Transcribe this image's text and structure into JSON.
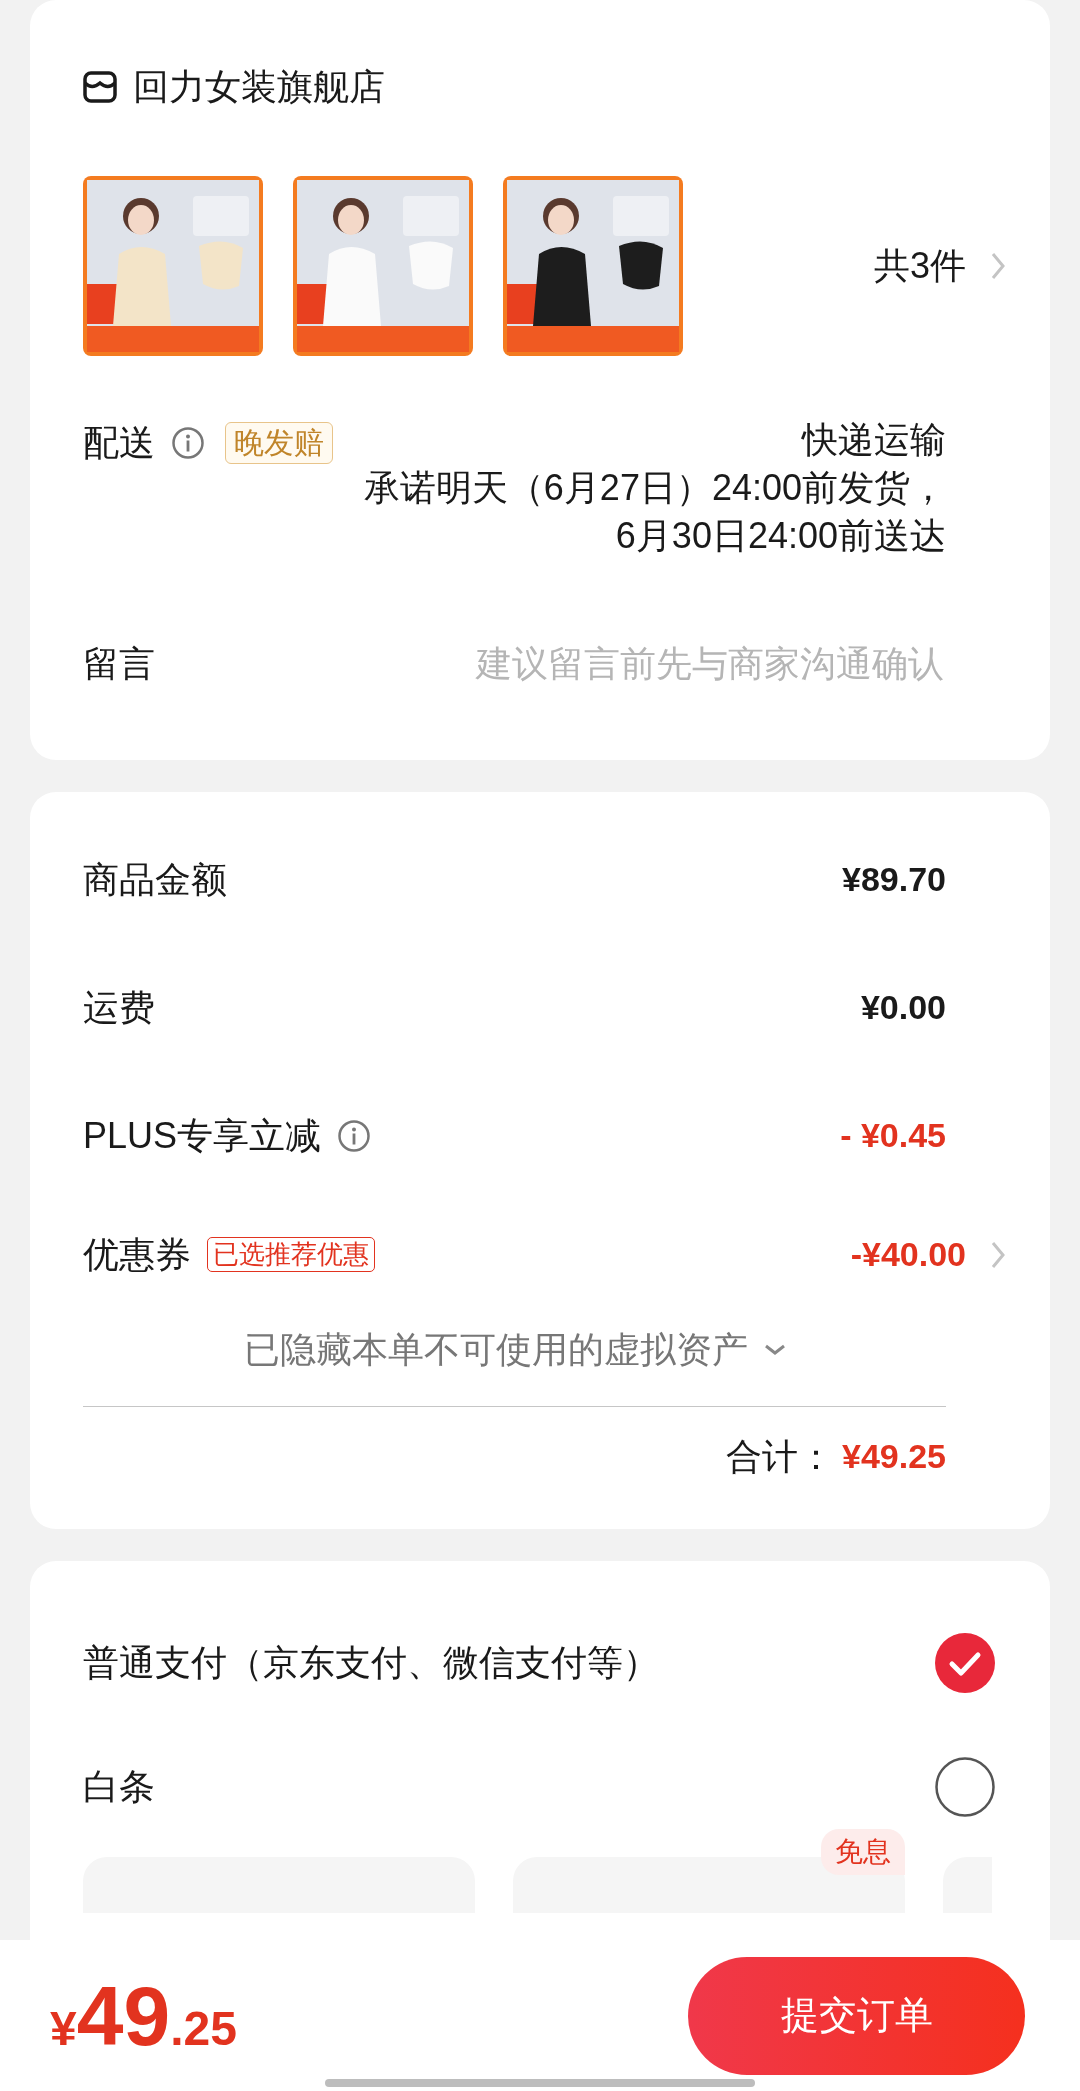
{
  "store": {
    "name": "回力女装旗舰店"
  },
  "products": {
    "count": "共3件"
  },
  "delivery": {
    "label": "配送",
    "badge": "晚发赔",
    "method": "快递运输",
    "promise_lines": [
      "承诺明天（6月27日）24:00前发货，",
      "6月30日24:00前送达"
    ]
  },
  "message": {
    "label": "留言",
    "placeholder": "建议留言前先与商家沟通确认"
  },
  "summary": {
    "rows": [
      {
        "kind": "plain",
        "label": "商品金额",
        "value": "¥89.70"
      },
      {
        "kind": "plain",
        "label": "运费",
        "value": "¥0.00"
      },
      {
        "kind": "discount",
        "label": "PLUS专享立减",
        "value": "- ¥0.45",
        "info": true
      },
      {
        "kind": "discount",
        "label": "优惠券",
        "tag": "已选推荐优惠",
        "value": "-¥40.00",
        "arrow": true
      }
    ],
    "hidden_note": "已隐藏本单不可使用的虚拟资产",
    "total_label": "合计：",
    "total": "¥49.25"
  },
  "payment": {
    "options": [
      {
        "label": "普通支付（京东支付、微信支付等）",
        "selected": true
      },
      {
        "label": "白条",
        "selected": false
      }
    ],
    "installments": [
      {
        "kind": "card"
      },
      {
        "kind": "card",
        "badge": "免息"
      },
      {
        "kind": "card"
      }
    ]
  },
  "footer": {
    "price_symbol": "¥",
    "price_int": "49",
    "price_dec": ".25",
    "submit": "提交订单"
  }
}
